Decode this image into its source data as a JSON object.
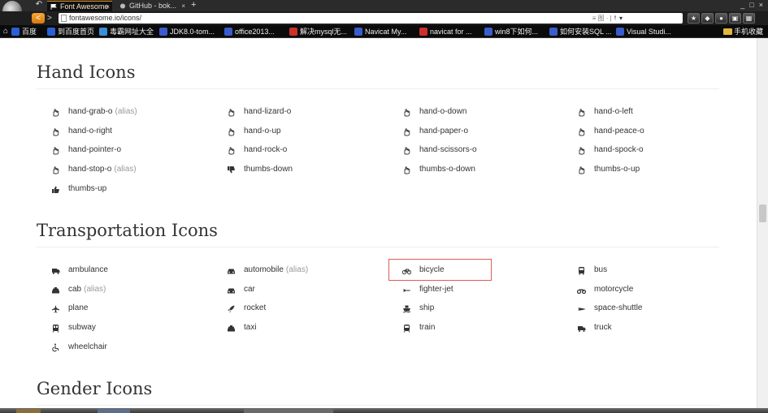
{
  "browser": {
    "tabs": [
      {
        "label": "Font Awesome",
        "active": true
      },
      {
        "label": "GitHub - bok...",
        "active": false
      }
    ],
    "new_tab_glyph": "+",
    "window_controls": [
      "_",
      "□",
      "×"
    ],
    "url": "fontawesome.io/icons/",
    "url_right_hint": "≡ 图 · | ↻ |",
    "search_placeholder": "▾",
    "toolbar_icons": [
      "star",
      "puzzle",
      "shield",
      "gamepad",
      "grid"
    ],
    "bookmarks": [
      {
        "label": "百度",
        "color": "#2a5fd6"
      },
      {
        "label": "到百度首页",
        "color": "#2a5fd6"
      },
      {
        "label": "毒霸网址大全",
        "color": "#3a8fd8"
      },
      {
        "label": "JDK8.0-tom...",
        "color": "#3b5ccc"
      },
      {
        "label": "office2013...",
        "color": "#3b5ccc"
      },
      {
        "label": "解决mysql无...",
        "color": "#c9312c"
      },
      {
        "label": "Navicat My...",
        "color": "#3b5ccc"
      },
      {
        "label": "navicat for ...",
        "color": "#c9312c"
      },
      {
        "label": "win8下如何...",
        "color": "#3b5ccc"
      },
      {
        "label": "如何安装SQL ...",
        "color": "#3b5ccc"
      },
      {
        "label": "Visual Studi...",
        "color": "#3b5ccc"
      }
    ],
    "mobile_bookmarks": "手机收藏"
  },
  "sections": [
    {
      "title": "Hand Icons",
      "items": [
        {
          "label": "hand-grab-o",
          "alias": "(alias)",
          "icon": "hand-grab-outline-icon",
          "solid": false
        },
        {
          "label": "hand-lizard-o",
          "alias": "",
          "icon": "hand-lizard-outline-icon",
          "solid": false
        },
        {
          "label": "hand-o-down",
          "alias": "",
          "icon": "hand-down-outline-icon",
          "solid": false
        },
        {
          "label": "hand-o-left",
          "alias": "",
          "icon": "hand-left-outline-icon",
          "solid": false
        },
        {
          "label": "hand-o-right",
          "alias": "",
          "icon": "hand-right-outline-icon",
          "solid": false
        },
        {
          "label": "hand-o-up",
          "alias": "",
          "icon": "hand-up-outline-icon",
          "solid": false
        },
        {
          "label": "hand-paper-o",
          "alias": "",
          "icon": "hand-paper-outline-icon",
          "solid": false
        },
        {
          "label": "hand-peace-o",
          "alias": "",
          "icon": "hand-peace-outline-icon",
          "solid": false
        },
        {
          "label": "hand-pointer-o",
          "alias": "",
          "icon": "hand-pointer-outline-icon",
          "solid": false
        },
        {
          "label": "hand-rock-o",
          "alias": "",
          "icon": "hand-rock-outline-icon",
          "solid": false
        },
        {
          "label": "hand-scissors-o",
          "alias": "",
          "icon": "hand-scissors-outline-icon",
          "solid": false
        },
        {
          "label": "hand-spock-o",
          "alias": "",
          "icon": "hand-spock-outline-icon",
          "solid": false
        },
        {
          "label": "hand-stop-o",
          "alias": "(alias)",
          "icon": "hand-stop-outline-icon",
          "solid": false
        },
        {
          "label": "thumbs-down",
          "alias": "",
          "icon": "thumbs-down-icon",
          "solid": true
        },
        {
          "label": "thumbs-o-down",
          "alias": "",
          "icon": "thumbs-down-outline-icon",
          "solid": false
        },
        {
          "label": "thumbs-o-up",
          "alias": "",
          "icon": "thumbs-up-outline-icon",
          "solid": false
        },
        {
          "label": "thumbs-up",
          "alias": "",
          "icon": "thumbs-up-icon",
          "solid": true
        }
      ]
    },
    {
      "title": "Transportation Icons",
      "items": [
        {
          "label": "ambulance",
          "alias": "",
          "icon": "ambulance-icon",
          "solid": true
        },
        {
          "label": "automobile",
          "alias": "(alias)",
          "icon": "car-icon",
          "solid": true
        },
        {
          "label": "bicycle",
          "alias": "",
          "icon": "bicycle-icon",
          "solid": true
        },
        {
          "label": "bus",
          "alias": "",
          "icon": "bus-icon",
          "solid": true
        },
        {
          "label": "cab",
          "alias": "(alias)",
          "icon": "taxi-icon",
          "solid": true
        },
        {
          "label": "car",
          "alias": "",
          "icon": "car-icon",
          "solid": true
        },
        {
          "label": "fighter-jet",
          "alias": "",
          "icon": "fighter-jet-icon",
          "solid": true
        },
        {
          "label": "motorcycle",
          "alias": "",
          "icon": "motorcycle-icon",
          "solid": true
        },
        {
          "label": "plane",
          "alias": "",
          "icon": "plane-icon",
          "solid": true
        },
        {
          "label": "rocket",
          "alias": "",
          "icon": "rocket-icon",
          "solid": true
        },
        {
          "label": "ship",
          "alias": "",
          "icon": "ship-icon",
          "solid": true
        },
        {
          "label": "space-shuttle",
          "alias": "",
          "icon": "space-shuttle-icon",
          "solid": true
        },
        {
          "label": "subway",
          "alias": "",
          "icon": "subway-icon",
          "solid": true
        },
        {
          "label": "taxi",
          "alias": "",
          "icon": "taxi-icon",
          "solid": true
        },
        {
          "label": "train",
          "alias": "",
          "icon": "train-icon",
          "solid": true
        },
        {
          "label": "truck",
          "alias": "",
          "icon": "truck-icon",
          "solid": true
        },
        {
          "label": "wheelchair",
          "alias": "",
          "icon": "wheelchair-icon",
          "solid": true
        }
      ]
    },
    {
      "title": "Gender Icons",
      "items": []
    }
  ],
  "highlighted_item": "bicycle",
  "colors": {
    "accent_orange": "#e8901f",
    "highlight": "#e05a5a",
    "text": "#333333",
    "alias": "#999999"
  }
}
